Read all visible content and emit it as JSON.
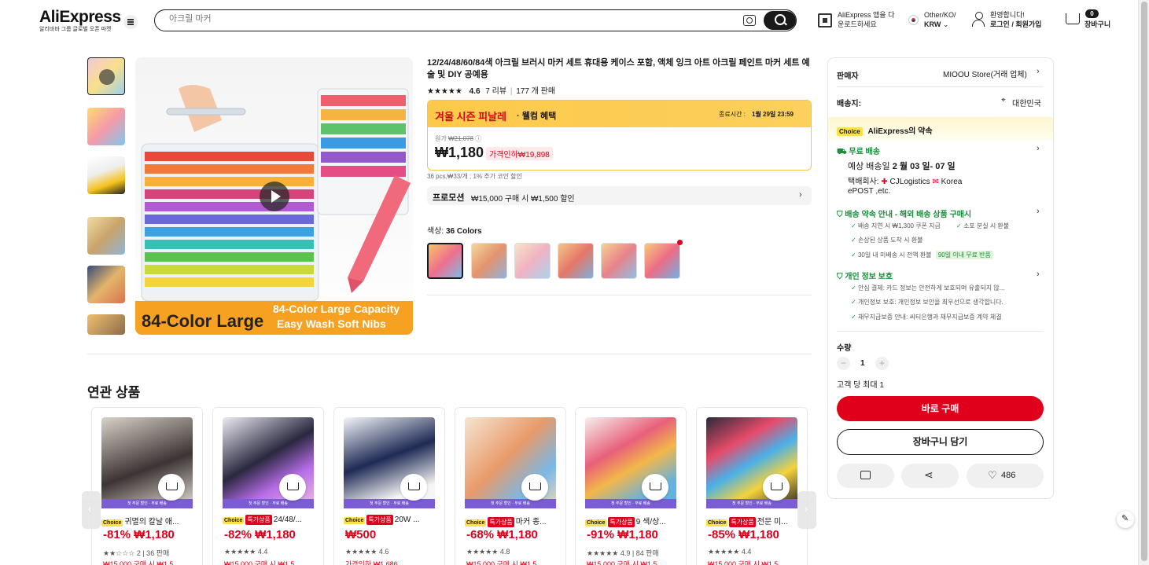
{
  "header": {
    "logo": "AliExpress",
    "logo_sub": "알리바바 그룹 글로벌 오픈 마켓",
    "search_placeholder": "아크릴 마커",
    "app_line1": "AliExpress 앱을 다",
    "app_line2": "운로드하세요",
    "locale_line1": "Other/KO/",
    "locale_line2": "KRW",
    "greet_line1": "환영합니다!",
    "greet_line2": "로그인 / 회원가입",
    "cart_count": "0",
    "cart_label": "장바구니"
  },
  "product": {
    "title": "12/24/48/60/84색 아크릴 브러시 마커 세트 휴대용 케이스 포함, 액체 잉크 아트 아크릴 페인트 마커 세트 예술 및 DIY 공예용",
    "stars": "★★★★★",
    "rating": "4.6",
    "reviews": "7 리뷰",
    "sold": "177 개 판매",
    "sale_title": "겨울 시즌 피날레",
    "sale_sub": "· 웰컴 혜택",
    "end_label": "종료시간 :",
    "end_time": "1월 29일 23:59",
    "orig_label": "원가",
    "orig_price": "₩21,078",
    "price": "₩1,180",
    "discount": "가격인하₩19,898",
    "unit_note": "36 pcs,₩33/개 ; 1% 추가 코인 할인",
    "promo_label": "프로모션",
    "promo_text": "₩15,000 구매 시 ₩1,500 할인",
    "color_label": "색상:",
    "color_value": "36 Colors",
    "image_banner1": "84-Color Large",
    "image_banner2": "84-Color Large Capacity",
    "image_banner3": "Easy Wash Soft Nibs"
  },
  "panel": {
    "seller_label": "판매자",
    "seller": "MIOOU Store(거래 업체)",
    "ship_label": "배송지:",
    "ship_to": "대한민국",
    "choice": "Choice",
    "promise": "AliExpress의 약속",
    "free_ship": "무료 배송",
    "eta_pre": "예상 배송일",
    "eta": "2 월 03 일- 07 일",
    "carrier_pre": "택배회사:",
    "carrier1": "CJLogistics",
    "carrier2": "Korea",
    "carrier3": "ePOST ,etc.",
    "guarantee_title": "배송 약속 안내 - 해외 배송 상품 구매시",
    "g1": "배송 지연 시 ₩1,300 쿠폰 지급",
    "g2": "소포 분실 시 환불",
    "g3": "손상된 상품 도착 시 환불",
    "g4": "30일 내 미배송 시 전액 환불",
    "g4_tag": "90일 이내 무료 반품",
    "privacy_title": "개인 정보 보호",
    "p1": "안심 결제: 카드 정보는 안전하게 보호되며 유출되지 않...",
    "p2": "개인정보 보호: 개인정보 보안을 최우선으로 생각합니다.",
    "p3": "채무지급보증 안내: 씨티은행과 채무지급보증 계약 체결",
    "qty_label": "수량",
    "qty": "1",
    "qty_limit": "고객 당 최대 1",
    "buy_now": "바로 구매",
    "add_cart": "장바구니 담기",
    "wish_count": "486"
  },
  "related": {
    "title": "연관 상품",
    "strip": "첫 주문 할인 · 무료 배송",
    "items": [
      {
        "tags": [
          "Choice"
        ],
        "name": "귀멸의 칼날 애...",
        "price": "-81% ₩1,180",
        "rating": "★★☆☆☆ 2 | 36 판매",
        "coupon": "₩15,000 구매 시 ₩1,5"
      },
      {
        "tags": [
          "Choice",
          "특가상품"
        ],
        "name": "24/48/...",
        "price": "-82% ₩1,180",
        "rating": "★★★★★ 4.4",
        "coupon": "₩15,000 구매 시 ₩1,5"
      },
      {
        "tags": [
          "Choice",
          "특가상품"
        ],
        "name": "20W ...",
        "price": "₩500",
        "rating": "★★★★★ 4.6",
        "coupon": "가격인하 ₩1,686"
      },
      {
        "tags": [
          "Choice",
          "특가상품"
        ],
        "name": "마커 종...",
        "price": "-68% ₩1,180",
        "rating": "★★★★★ 4.8",
        "coupon": "₩15,000 구매 시 ₩1,5"
      },
      {
        "tags": [
          "Choice",
          "특가상품"
        ],
        "name": "9 색/상...",
        "price": "-91% ₩1,180",
        "rating": "★★★★★ 4.9 | 84 판매",
        "coupon": "₩15,000 구매 시 ₩1,5"
      },
      {
        "tags": [
          "Choice",
          "특가상품"
        ],
        "name": "전문 미...",
        "price": "-85% ₩1,180",
        "rating": "★★★★★ 4.4",
        "coupon": "₩15,000 구매 시 ₩1,5"
      }
    ]
  },
  "colors": {
    "accent": "#e0001b",
    "choice": "#fde14b",
    "sale_bg": "#fdc94a",
    "green": "#1a8c3a"
  },
  "icons": [
    "menu-icon",
    "camera-search-icon",
    "search-icon",
    "qr-icon",
    "user-icon",
    "cart-icon",
    "play-icon",
    "chevron-right-icon",
    "location-pin-icon",
    "truck-icon",
    "shield-icon",
    "check-icon",
    "store-icon",
    "share-icon",
    "heart-icon",
    "minus-icon",
    "plus-icon",
    "edit-icon"
  ]
}
